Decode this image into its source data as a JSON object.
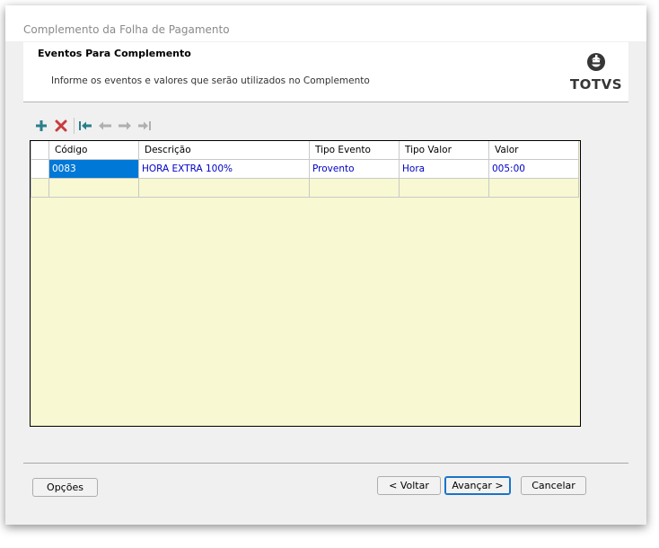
{
  "window": {
    "title": "Complemento da Folha de Pagamento"
  },
  "header": {
    "title": "Eventos Para Complemento",
    "subtitle": "Informe os eventos e valores que serão utilizados no Complemento",
    "logo_text": "TOTVS"
  },
  "toolbar": {
    "buttons": [
      {
        "name": "add",
        "icon": "plus-icon",
        "color": "#2a7f8a"
      },
      {
        "name": "delete",
        "icon": "x-icon",
        "color": "#c83c3c"
      },
      {
        "name": "first",
        "icon": "first-icon",
        "color": "#2a7f8a"
      },
      {
        "name": "prev",
        "icon": "arrow-left-icon",
        "color": "#b0b0b0"
      },
      {
        "name": "next",
        "icon": "arrow-right-icon",
        "color": "#b0b0b0"
      },
      {
        "name": "last",
        "icon": "last-icon",
        "color": "#b0b0b0"
      }
    ]
  },
  "grid": {
    "columns": [
      "Código",
      "Descrição",
      "Tipo Evento",
      "Tipo Valor",
      "Valor"
    ],
    "rows": [
      {
        "codigo": "0083",
        "descricao": "HORA EXTRA 100%",
        "tipo_evento": "Provento",
        "tipo_valor": "Hora",
        "valor": "005:00"
      }
    ]
  },
  "buttons": {
    "opcoes": "Opções",
    "voltar": "< Voltar",
    "avancar": "Avançar >",
    "cancelar": "Cancelar"
  },
  "colors": {
    "grid_background": "#f8f8d2",
    "selection": "#0078d7",
    "data_text": "#0000c8"
  }
}
